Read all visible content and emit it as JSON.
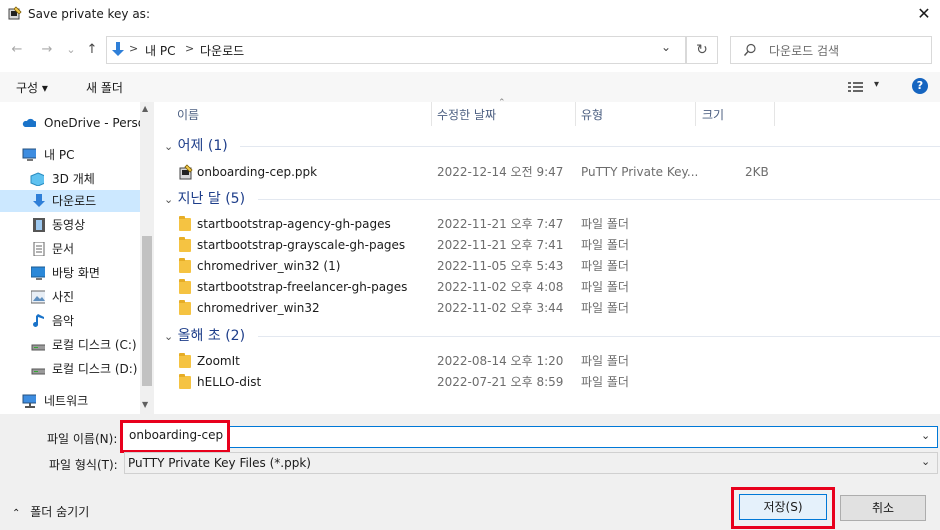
{
  "window": {
    "title": "Save private key as:",
    "close_glyph": "✕"
  },
  "nav": {
    "back_glyph": "←",
    "forward_glyph": "→",
    "recent_glyph": "⌄",
    "up_glyph": "↑",
    "breadcrumb": [
      "내 PC",
      "다운로드"
    ],
    "separator": ">",
    "dropdown_glyph": "⌄",
    "refresh_glyph": "↻",
    "search_placeholder": "다운로드 검색"
  },
  "toolbar": {
    "organize": "구성",
    "new_folder": "새 폴더",
    "view_icon": "view-details-icon",
    "help": "?"
  },
  "sidebar": {
    "items": [
      {
        "label": "OneDrive - Person",
        "icon": "cloud-icon"
      },
      {
        "label": "내 PC",
        "icon": "computer-icon"
      },
      {
        "label": "3D 개체",
        "icon": "cube-icon"
      },
      {
        "label": "다운로드",
        "icon": "download-icon",
        "selected": true
      },
      {
        "label": "동영상",
        "icon": "film-icon"
      },
      {
        "label": "문서",
        "icon": "document-icon"
      },
      {
        "label": "바탕 화면",
        "icon": "desktop-icon"
      },
      {
        "label": "사진",
        "icon": "picture-icon"
      },
      {
        "label": "음악",
        "icon": "music-icon"
      },
      {
        "label": "로컬 디스크 (C:)",
        "icon": "drive-icon"
      },
      {
        "label": "로컬 디스크 (D:)",
        "icon": "drive-icon"
      },
      {
        "label": "네트워크",
        "icon": "network-icon"
      }
    ]
  },
  "columns": {
    "name": "이름",
    "date": "수정한 날짜",
    "type": "유형",
    "size": "크기"
  },
  "groups": [
    {
      "label": "어제 (1)",
      "files": [
        {
          "name": "onboarding-cep.ppk",
          "date": "2022-12-14 오전 9:47",
          "type": "PuTTY Private Key...",
          "size": "2KB",
          "icon": "putty-key-icon"
        }
      ]
    },
    {
      "label": "지난 달 (5)",
      "files": [
        {
          "name": "startbootstrap-agency-gh-pages",
          "date": "2022-11-21 오후 7:47",
          "type": "파일 폴더",
          "size": "",
          "icon": "folder-icon"
        },
        {
          "name": "startbootstrap-grayscale-gh-pages",
          "date": "2022-11-21 오후 7:41",
          "type": "파일 폴더",
          "size": "",
          "icon": "folder-icon"
        },
        {
          "name": "chromedriver_win32 (1)",
          "date": "2022-11-05 오후 5:43",
          "type": "파일 폴더",
          "size": "",
          "icon": "folder-icon"
        },
        {
          "name": "startbootstrap-freelancer-gh-pages",
          "date": "2022-11-02 오후 4:08",
          "type": "파일 폴더",
          "size": "",
          "icon": "folder-icon"
        },
        {
          "name": "chromedriver_win32",
          "date": "2022-11-02 오후 3:44",
          "type": "파일 폴더",
          "size": "",
          "icon": "folder-icon"
        }
      ]
    },
    {
      "label": "올해 초 (2)",
      "files": [
        {
          "name": "ZoomIt",
          "date": "2022-08-14 오후 1:20",
          "type": "파일 폴더",
          "size": "",
          "icon": "folder-icon"
        },
        {
          "name": "hELLO-dist",
          "date": "2022-07-21 오후 8:59",
          "type": "파일 폴더",
          "size": "",
          "icon": "folder-icon"
        }
      ]
    }
  ],
  "form": {
    "filename_label": "파일 이름(N):",
    "filename_value": "onboarding-cep",
    "filetype_label": "파일 형식(T):",
    "filetype_value": "PuTTY Private Key Files (*.ppk)"
  },
  "footer": {
    "hide_folders": "폴더 숨기기",
    "save": "저장(S)",
    "cancel": "취소"
  },
  "colors": {
    "highlight_red": "#e8001c",
    "selection_blue": "#cce8ff",
    "accent": "#0078d7"
  }
}
